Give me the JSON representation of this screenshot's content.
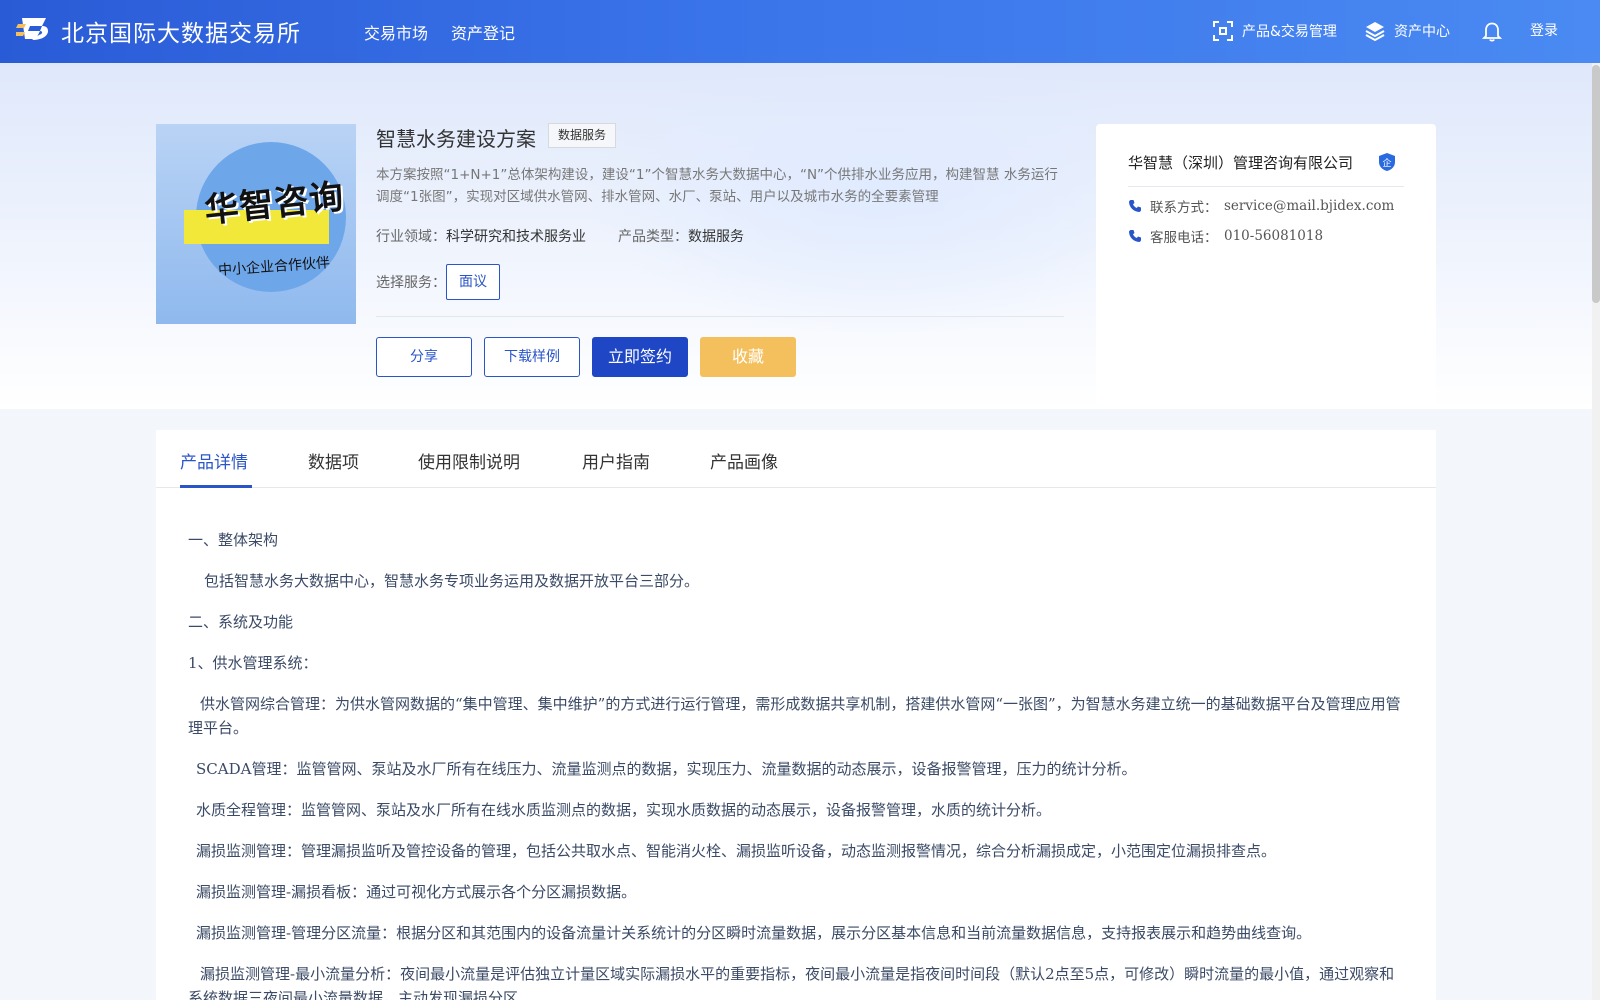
{
  "header": {
    "brand": "北京国际大数据交易所",
    "nav": [
      "交易市场",
      "资产登记"
    ],
    "product_mgmt": "产品&交易管理",
    "asset_center": "资产中心",
    "login": "登录"
  },
  "product": {
    "image_title": "华智咨询",
    "image_subtitle": "中小企业合作伙伴",
    "title": "智慧水务建设方案",
    "tag": "数据服务",
    "description": "本方案按照“1+N+1”总体架构建设，建设“1”个智慧水务大数据中心，“N”个供排水业务应用，构建智慧 水务运行调度“1张图”，实现对区域供水管网、排水管网、水厂、泵站、用户以及城市水务的全要素管理",
    "industry_label": "行业领域：",
    "industry_value": "科学研究和技术服务业",
    "type_label": "产品类型：",
    "type_value": "数据服务",
    "select_label": "选择服务：",
    "service_option": "面议",
    "buttons": {
      "share": "分享",
      "download": "下载样例",
      "sign": "立即签约",
      "favorite": "收藏"
    }
  },
  "company": {
    "name": "华智慧（深圳）管理咨询有限公司",
    "badge": "企",
    "contact_label": "联系方式：",
    "contact_value": "service@mail.bjidex.com",
    "phone_label": "客服电话：",
    "phone_value": "010-56081018"
  },
  "tabs": [
    "产品详情",
    "数据项",
    "使用限制说明",
    "用户指南",
    "产品画像"
  ],
  "active_tab": "产品详情",
  "content": [
    "一、整体架构",
    "包括智慧水务大数据中心，智慧水务专项业务运用及数据开放平台三部分。",
    "二、系统及功能",
    "1、供水管理系统：",
    "供水管网综合管理：为供水管网数据的“集中管理、集中维护”的方式进行运行管理，需形成数据共享机制，搭建供水管网“一张图”，为智慧水务建立统一的基础数据平台及管理应用管理平台。",
    "SCADA管理：监管管网、泵站及水厂所有在线压力、流量监测点的数据，实现压力、流量数据的动态展示，设备报警管理，压力的统计分析。",
    "水质全程管理：监管管网、泵站及水厂所有在线水质监测点的数据，实现水质数据的动态展示，设备报警管理，水质的统计分析。",
    "漏损监测管理：管理漏损监听及管控设备的管理，包括公共取水点、智能消火栓、漏损监听设备，动态监测报警情况，综合分析漏损成定，小范围定位漏损排查点。",
    "漏损监测管理-漏损看板：通过可视化方式展示各个分区漏损数据。",
    "漏损监测管理-管理分区流量：根据分区和其范围内的设备流量计关系统计的分区瞬时流量数据，展示分区基本信息和当前流量数据信息，支持报表展示和趋势曲线查询。",
    "漏损监测管理-最小流量分析：夜间最小流量是评估独立计量区域实际漏损水平的重要指标，夜间最小流量是指夜间时间段（默认2点至5点，可修改）瞬时流量的最小值，通过观察和系统数据三夜间最小流量数据，主动发现漏损分区"
  ]
}
